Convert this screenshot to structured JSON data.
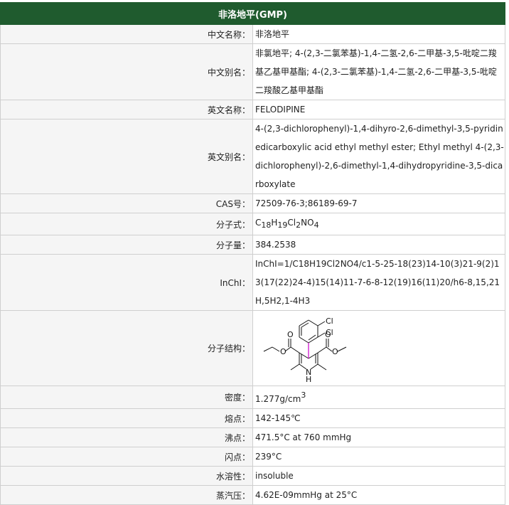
{
  "title": "非洛地平(GMP)",
  "rows": {
    "cn_name": {
      "label": "中文名称：",
      "value": "非洛地平"
    },
    "cn_alias": {
      "label": "中文别名：",
      "value": "非氯地平; 4-(2,3-二氯苯基)-1,4-二氢-2,6-二甲基-3,5-吡啶二羧基乙基甲基酯; 4-(2,3-二氯苯基)-1,4-二氢-2,6-二甲基-3,5-吡啶二羧酸乙基甲基酯"
    },
    "en_name": {
      "label": "英文名称：",
      "value": "FELODIPINE"
    },
    "en_alias": {
      "label": "英文别名：",
      "value": "4-(2,3-dichlorophenyl)-1,4-dihyro-2,6-dimethyl-3,5-pyridinedicarboxylic acid ethyl methyl ester; Ethyl methyl 4-(2,3-dichlorophenyl)-2,6-dimethyl-1,4-dihydropyridine-3,5-dicarboxylate"
    },
    "cas": {
      "label": "CAS号：",
      "value": "72509-76-3;86189-69-7"
    },
    "formula": {
      "label": "分子式：",
      "parts": [
        "C",
        "18",
        "H",
        "19",
        "Cl",
        "2",
        "NO",
        "4"
      ]
    },
    "mw": {
      "label": "分子量：",
      "value": "384.2538"
    },
    "inchi": {
      "label": "InChI：",
      "value": "InChI=1/C18H19Cl2NO4/c1-5-25-18(23)14-10(3)21-9(2)13(17(22)24-4)15(14)11-7-6-8-12(19)16(11)20/h6-8,15,21H,5H2,1-4H3"
    },
    "structure": {
      "label": "分子结构：",
      "atoms": {
        "cl1": "Cl",
        "cl2": "Cl",
        "o": "O",
        "n": "N",
        "h": "H"
      }
    },
    "density": {
      "label": "密度：",
      "value": "1.277g/cm",
      "sup": "3"
    },
    "mp": {
      "label": "熔点：",
      "value": "142-145℃"
    },
    "bp": {
      "label": "沸点：",
      "value": "471.5°C at 760 mmHg"
    },
    "fp": {
      "label": "闪点：",
      "value": "239°C"
    },
    "solubility": {
      "label": "水溶性：",
      "value": "insoluble"
    },
    "vapor": {
      "label": "蒸汽压：",
      "value": "4.62E-09mmHg at 25°C"
    }
  },
  "colors": {
    "header_bg": "#1f5b2e",
    "label_bg": "#f5f5f5",
    "border": "#cfcfcf",
    "stereo_bond": "#cc00cc"
  }
}
